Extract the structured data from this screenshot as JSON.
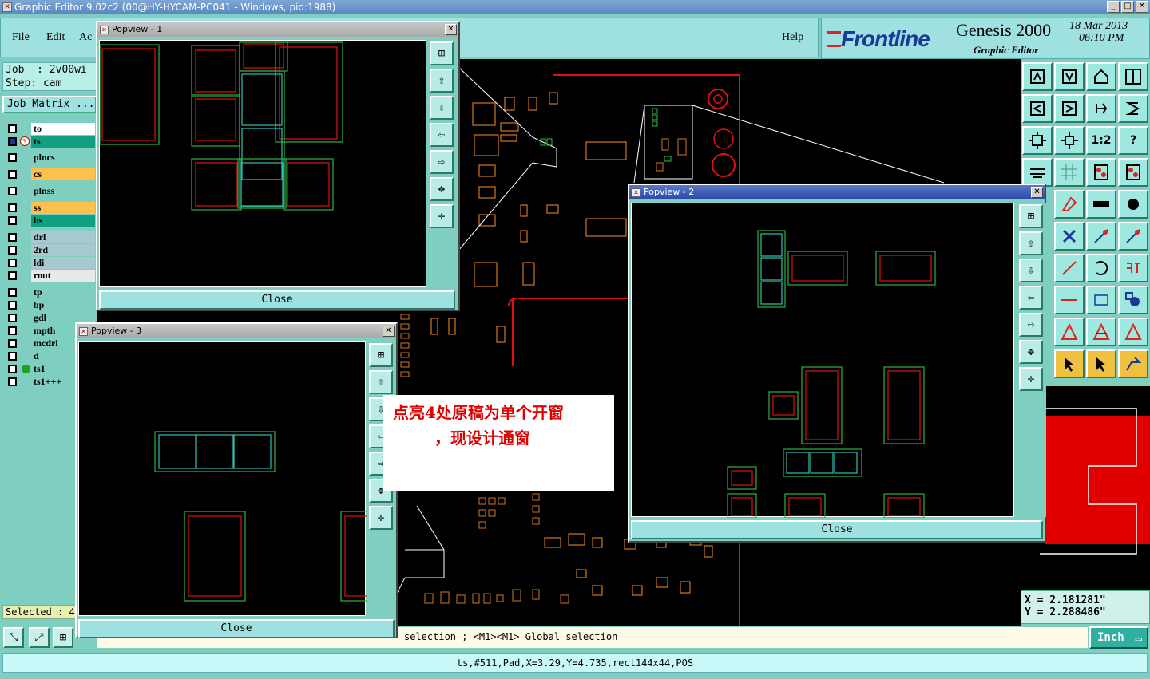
{
  "window": {
    "title": "Graphic Editor 9.02c2 (00@HY-HYCAM-PC041 - Windows, pid:1988)",
    "app_icon": "editor-icon",
    "minimize": "_",
    "maximize": "□",
    "close": "✕"
  },
  "menu": {
    "file": "File",
    "edit": "Edit",
    "actions": "Ac",
    "help": "Help"
  },
  "brand": {
    "logo": "Frontline",
    "product": "Genesis 2000",
    "subtitle": "Graphic Editor",
    "date": "18 Mar 2013",
    "time": "06:10 PM"
  },
  "job": {
    "job_line": "Job  : 2v00wi",
    "step_line": "Step: cam",
    "matrix_button": "Job Matrix ..."
  },
  "layers": [
    {
      "name": "to",
      "color": "#ffffff"
    },
    {
      "name": "ts",
      "color": "#10a080",
      "active": true
    },
    {
      "name": "plncs",
      "color": "#7fcfc0"
    },
    {
      "name": "cs",
      "color": "#ffc04c"
    },
    {
      "name": "plnss",
      "color": "#7fcfc0"
    },
    {
      "name": "ss",
      "color": "#ffc04c"
    },
    {
      "name": "bs",
      "color": "#10a080"
    },
    {
      "name": "drl",
      "color": "#a8c8d0"
    },
    {
      "name": "2rd",
      "color": "#a8c8d0"
    },
    {
      "name": "ldi",
      "color": "#a8c8d0"
    },
    {
      "name": "rout",
      "color": "#e8e8e8"
    },
    {
      "name": "tp",
      "color": "#7fcfc0"
    },
    {
      "name": "bp",
      "color": "#7fcfc0"
    },
    {
      "name": "gdl",
      "color": "#7fcfc0"
    },
    {
      "name": "mpth",
      "color": "#7fcfc0"
    },
    {
      "name": "mcdrl",
      "color": "#7fcfc0"
    },
    {
      "name": "d",
      "color": "#7fcfc0"
    },
    {
      "name": "ts1",
      "color": "#7fcfc0",
      "dot": true
    },
    {
      "name": "ts1+++",
      "color": "#7fcfc0"
    }
  ],
  "selected": "Selected : 4",
  "popviews": {
    "p1": {
      "title": "Popview - 1",
      "close": "Close",
      "x": "✕"
    },
    "p2": {
      "title": "Popview - 2",
      "close": "Close",
      "x": "✕"
    },
    "p3": {
      "title": "Popview - 3",
      "close": "Close",
      "x": "✕"
    }
  },
  "annotation": {
    "line1": "点亮4处原稿为单个开窗",
    "line2": "，现设计通窗"
  },
  "coords": {
    "x": "X = 2.181281\"",
    "y": "Y = 2.288486\""
  },
  "message": "selection ; <M1><M1> Global selection",
  "units": "Inch",
  "status": "ts,#511,Pad,X=3.29,Y=4.735,rect144x44,POS",
  "tool_labels": {
    "one_to_two": "1:2",
    "help": "?"
  }
}
